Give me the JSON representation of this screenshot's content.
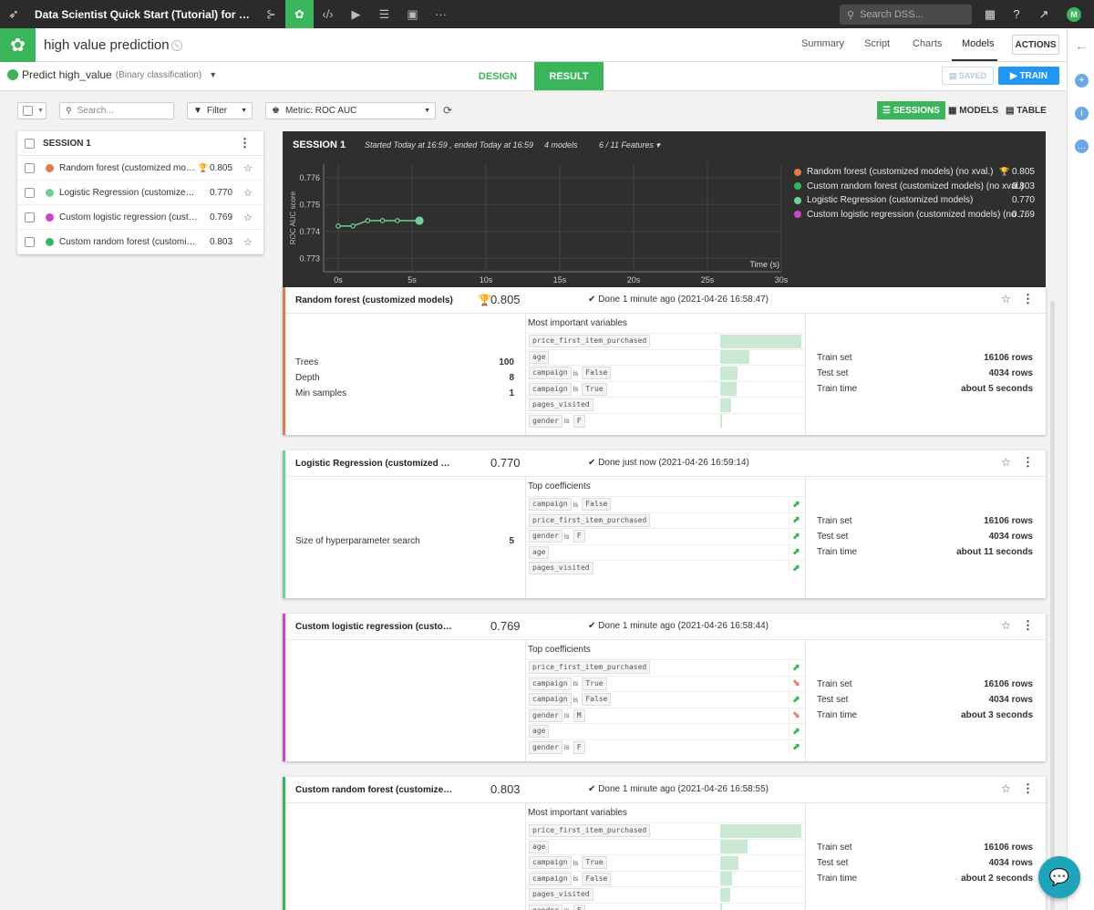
{
  "topbar": {
    "project_title": "Data Scientist Quick Start (Tutorial) for ma...",
    "search_placeholder": "Search DSS...",
    "avatar_initial": "M"
  },
  "header": {
    "title": "high value prediction",
    "tabs": [
      "Summary",
      "Script",
      "Charts",
      "Models"
    ],
    "active_tab": "Models",
    "actions_label": "ACTIONS"
  },
  "subheader": {
    "predict_label": "Predict high_value",
    "predict_type": "(Binary classification)",
    "design_label": "DESIGN",
    "result_label": "RESULT",
    "saved_label": "SAVED",
    "train_label": "TRAIN"
  },
  "toolbar": {
    "search_placeholder": "Search...",
    "filter_label": "Filter",
    "metric_label": "Metric: ROC AUC",
    "sessions_label": "SESSIONS",
    "models_label": "MODELS",
    "table_label": "TABLE"
  },
  "session_list": {
    "title": "SESSION 1",
    "items": [
      {
        "name": "Random forest (customized models) (no xval.)",
        "score": "0.805",
        "color": "#e07b4f",
        "best": true
      },
      {
        "name": "Logistic Regression (customized models)",
        "score": "0.770",
        "color": "#6fcf97",
        "best": false
      },
      {
        "name": "Custom logistic regression (customized models) (no xval.)",
        "score": "0.769",
        "color": "#cc44cc",
        "best": false
      },
      {
        "name": "Custom random forest (customized models) (no xval.)",
        "score": "0.803",
        "color": "#3bb55b",
        "best": false
      }
    ]
  },
  "session_panel": {
    "title": "SESSION 1",
    "started": "Started Today at 16:59 , ended Today at 16:59",
    "models_count": "4 models",
    "features": "6 / 11 Features",
    "legend": [
      {
        "name": "Random forest (customized models) (no xval.)",
        "score": "0.805",
        "color": "#e07b4f",
        "best": true
      },
      {
        "name": "Custom random forest (customized models) (no xval.)",
        "score": "0.803",
        "color": "#3bb55b",
        "best": false
      },
      {
        "name": "Logistic Regression (customized models)",
        "score": "0.770",
        "color": "#6fcf97",
        "best": false
      },
      {
        "name": "Custom logistic regression (customized models) (no ...",
        "score": "0.769",
        "color": "#cc44cc",
        "best": false
      }
    ]
  },
  "chart_data": {
    "type": "line",
    "ylabel": "ROC AUC score",
    "xlabel": "Time (s)",
    "x_ticks": [
      "0s",
      "5s",
      "10s",
      "15s",
      "20s",
      "25s",
      "30s"
    ],
    "y_ticks": [
      "0.776",
      "0.775",
      "0.774",
      "0.773"
    ],
    "xlim": [
      0,
      30
    ],
    "ylim": [
      0.7725,
      0.7765
    ],
    "series": [
      {
        "color": "#6fcf97",
        "x": [
          0,
          1,
          2,
          3,
          4,
          5.5
        ],
        "y": [
          0.7742,
          0.7742,
          0.7744,
          0.7744,
          0.7744,
          0.7744
        ]
      }
    ]
  },
  "cards": [
    {
      "title": "Random forest (customized models)",
      "score": "0.805",
      "best": true,
      "done": "Done 1 minute ago (2021-04-26 16:58:47)",
      "color": "#e07b4f",
      "params": [
        [
          "Trees",
          "100"
        ],
        [
          "Depth",
          "8"
        ],
        [
          "Min samples",
          "1"
        ]
      ],
      "vars_title": "Most important variables",
      "vars": [
        {
          "parts": [
            "price_first_item_purchased"
          ],
          "importance": 1.0
        },
        {
          "parts": [
            "age"
          ],
          "importance": 0.36
        },
        {
          "parts": [
            "campaign",
            "is",
            "False"
          ],
          "importance": 0.21
        },
        {
          "parts": [
            "campaign",
            "is",
            "True"
          ],
          "importance": 0.2
        },
        {
          "parts": [
            "pages_visited"
          ],
          "importance": 0.14
        },
        {
          "parts": [
            "gender",
            "is",
            "F"
          ],
          "importance": 0.02
        }
      ],
      "train": [
        [
          "Train set",
          "16106 rows"
        ],
        [
          "Test set",
          "4034 rows"
        ],
        [
          "Train time",
          "about 5 seconds"
        ]
      ]
    },
    {
      "title": "Logistic Regression (customized models)",
      "score": "0.770",
      "best": false,
      "done": "Done just now (2021-04-26 16:59:14)",
      "color": "#6fcf97",
      "params": [
        [
          "Size of hyperparameter search",
          "5"
        ]
      ],
      "vars_title": "Top coefficients",
      "coefs": [
        {
          "parts": [
            "campaign",
            "is",
            "False"
          ],
          "sign": "up"
        },
        {
          "parts": [
            "price_first_item_purchased"
          ],
          "sign": "up"
        },
        {
          "parts": [
            "gender",
            "is",
            "F"
          ],
          "sign": "up"
        },
        {
          "parts": [
            "age"
          ],
          "sign": "up"
        },
        {
          "parts": [
            "pages_visited"
          ],
          "sign": "up"
        }
      ],
      "train": [
        [
          "Train set",
          "16106 rows"
        ],
        [
          "Test set",
          "4034 rows"
        ],
        [
          "Train time",
          "about 11 seconds"
        ]
      ]
    },
    {
      "title": "Custom logistic regression (customized models)",
      "score": "0.769",
      "best": false,
      "done": "Done 1 minute ago (2021-04-26 16:58:44)",
      "color": "#cc44cc",
      "params": [],
      "vars_title": "Top coefficients",
      "coefs": [
        {
          "parts": [
            "price_first_item_purchased"
          ],
          "sign": "up"
        },
        {
          "parts": [
            "campaign",
            "is",
            "True"
          ],
          "sign": "down"
        },
        {
          "parts": [
            "campaign",
            "is",
            "False"
          ],
          "sign": "up"
        },
        {
          "parts": [
            "gender",
            "is",
            "M"
          ],
          "sign": "down"
        },
        {
          "parts": [
            "age"
          ],
          "sign": "up"
        },
        {
          "parts": [
            "gender",
            "is",
            "F"
          ],
          "sign": "up"
        }
      ],
      "train": [
        [
          "Train set",
          "16106 rows"
        ],
        [
          "Test set",
          "4034 rows"
        ],
        [
          "Train time",
          "about 3 seconds"
        ]
      ]
    },
    {
      "title": "Custom random forest (customized models)",
      "score": "0.803",
      "best": false,
      "done": "Done 1 minute ago (2021-04-26 16:58:55)",
      "color": "#3bb55b",
      "params": [],
      "vars_title": "Most important variables",
      "vars": [
        {
          "parts": [
            "price_first_item_purchased"
          ],
          "importance": 1.0
        },
        {
          "parts": [
            "age"
          ],
          "importance": 0.34
        },
        {
          "parts": [
            "campaign",
            "is",
            "True"
          ],
          "importance": 0.22
        },
        {
          "parts": [
            "campaign",
            "is",
            "False"
          ],
          "importance": 0.15
        },
        {
          "parts": [
            "pages_visited"
          ],
          "importance": 0.12
        },
        {
          "parts": [
            "gender",
            "is",
            "F"
          ],
          "importance": 0.02
        }
      ],
      "train": [
        [
          "Train set",
          "16106 rows"
        ],
        [
          "Test set",
          "4034 rows"
        ],
        [
          "Train time",
          "about 2 seconds"
        ]
      ]
    }
  ]
}
